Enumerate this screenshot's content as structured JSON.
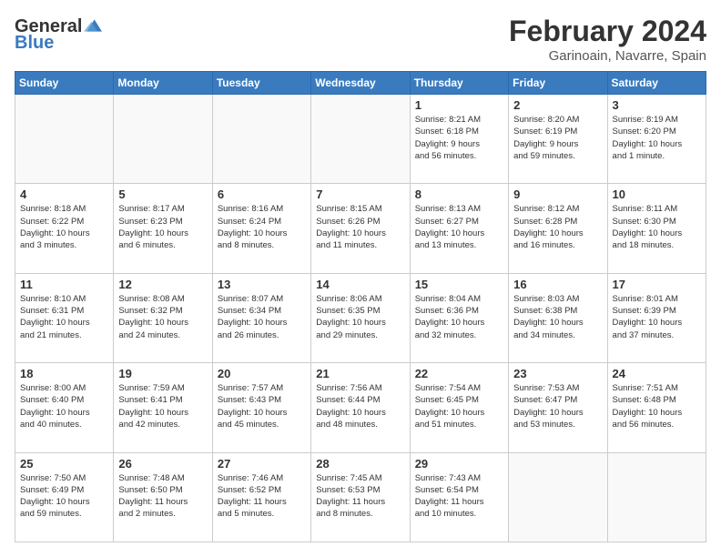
{
  "logo": {
    "line1": "General",
    "line2": "Blue"
  },
  "title": "February 2024",
  "subtitle": "Garinoain, Navarre, Spain",
  "weekdays": [
    "Sunday",
    "Monday",
    "Tuesday",
    "Wednesday",
    "Thursday",
    "Friday",
    "Saturday"
  ],
  "weeks": [
    [
      {
        "day": "",
        "info": ""
      },
      {
        "day": "",
        "info": ""
      },
      {
        "day": "",
        "info": ""
      },
      {
        "day": "",
        "info": ""
      },
      {
        "day": "1",
        "info": "Sunrise: 8:21 AM\nSunset: 6:18 PM\nDaylight: 9 hours\nand 56 minutes."
      },
      {
        "day": "2",
        "info": "Sunrise: 8:20 AM\nSunset: 6:19 PM\nDaylight: 9 hours\nand 59 minutes."
      },
      {
        "day": "3",
        "info": "Sunrise: 8:19 AM\nSunset: 6:20 PM\nDaylight: 10 hours\nand 1 minute."
      }
    ],
    [
      {
        "day": "4",
        "info": "Sunrise: 8:18 AM\nSunset: 6:22 PM\nDaylight: 10 hours\nand 3 minutes."
      },
      {
        "day": "5",
        "info": "Sunrise: 8:17 AM\nSunset: 6:23 PM\nDaylight: 10 hours\nand 6 minutes."
      },
      {
        "day": "6",
        "info": "Sunrise: 8:16 AM\nSunset: 6:24 PM\nDaylight: 10 hours\nand 8 minutes."
      },
      {
        "day": "7",
        "info": "Sunrise: 8:15 AM\nSunset: 6:26 PM\nDaylight: 10 hours\nand 11 minutes."
      },
      {
        "day": "8",
        "info": "Sunrise: 8:13 AM\nSunset: 6:27 PM\nDaylight: 10 hours\nand 13 minutes."
      },
      {
        "day": "9",
        "info": "Sunrise: 8:12 AM\nSunset: 6:28 PM\nDaylight: 10 hours\nand 16 minutes."
      },
      {
        "day": "10",
        "info": "Sunrise: 8:11 AM\nSunset: 6:30 PM\nDaylight: 10 hours\nand 18 minutes."
      }
    ],
    [
      {
        "day": "11",
        "info": "Sunrise: 8:10 AM\nSunset: 6:31 PM\nDaylight: 10 hours\nand 21 minutes."
      },
      {
        "day": "12",
        "info": "Sunrise: 8:08 AM\nSunset: 6:32 PM\nDaylight: 10 hours\nand 24 minutes."
      },
      {
        "day": "13",
        "info": "Sunrise: 8:07 AM\nSunset: 6:34 PM\nDaylight: 10 hours\nand 26 minutes."
      },
      {
        "day": "14",
        "info": "Sunrise: 8:06 AM\nSunset: 6:35 PM\nDaylight: 10 hours\nand 29 minutes."
      },
      {
        "day": "15",
        "info": "Sunrise: 8:04 AM\nSunset: 6:36 PM\nDaylight: 10 hours\nand 32 minutes."
      },
      {
        "day": "16",
        "info": "Sunrise: 8:03 AM\nSunset: 6:38 PM\nDaylight: 10 hours\nand 34 minutes."
      },
      {
        "day": "17",
        "info": "Sunrise: 8:01 AM\nSunset: 6:39 PM\nDaylight: 10 hours\nand 37 minutes."
      }
    ],
    [
      {
        "day": "18",
        "info": "Sunrise: 8:00 AM\nSunset: 6:40 PM\nDaylight: 10 hours\nand 40 minutes."
      },
      {
        "day": "19",
        "info": "Sunrise: 7:59 AM\nSunset: 6:41 PM\nDaylight: 10 hours\nand 42 minutes."
      },
      {
        "day": "20",
        "info": "Sunrise: 7:57 AM\nSunset: 6:43 PM\nDaylight: 10 hours\nand 45 minutes."
      },
      {
        "day": "21",
        "info": "Sunrise: 7:56 AM\nSunset: 6:44 PM\nDaylight: 10 hours\nand 48 minutes."
      },
      {
        "day": "22",
        "info": "Sunrise: 7:54 AM\nSunset: 6:45 PM\nDaylight: 10 hours\nand 51 minutes."
      },
      {
        "day": "23",
        "info": "Sunrise: 7:53 AM\nSunset: 6:47 PM\nDaylight: 10 hours\nand 53 minutes."
      },
      {
        "day": "24",
        "info": "Sunrise: 7:51 AM\nSunset: 6:48 PM\nDaylight: 10 hours\nand 56 minutes."
      }
    ],
    [
      {
        "day": "25",
        "info": "Sunrise: 7:50 AM\nSunset: 6:49 PM\nDaylight: 10 hours\nand 59 minutes."
      },
      {
        "day": "26",
        "info": "Sunrise: 7:48 AM\nSunset: 6:50 PM\nDaylight: 11 hours\nand 2 minutes."
      },
      {
        "day": "27",
        "info": "Sunrise: 7:46 AM\nSunset: 6:52 PM\nDaylight: 11 hours\nand 5 minutes."
      },
      {
        "day": "28",
        "info": "Sunrise: 7:45 AM\nSunset: 6:53 PM\nDaylight: 11 hours\nand 8 minutes."
      },
      {
        "day": "29",
        "info": "Sunrise: 7:43 AM\nSunset: 6:54 PM\nDaylight: 11 hours\nand 10 minutes."
      },
      {
        "day": "",
        "info": ""
      },
      {
        "day": "",
        "info": ""
      }
    ]
  ]
}
